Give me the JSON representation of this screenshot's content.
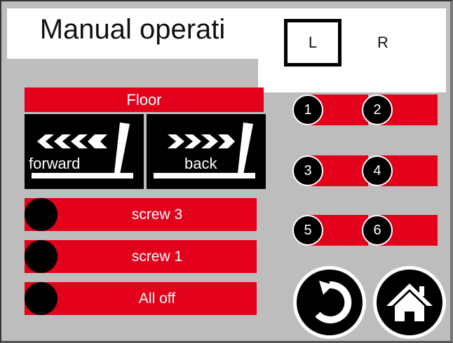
{
  "header": {
    "title": "Manual operati"
  },
  "side_selector": {
    "left_label": "L",
    "right_label": "R",
    "selected": "L"
  },
  "floor": {
    "label": "Floor"
  },
  "direction_buttons": {
    "forward_label": "forward",
    "back_label": "back"
  },
  "screw_buttons": [
    {
      "label": "screw 3"
    },
    {
      "label": "screw 1"
    },
    {
      "label": "All off"
    }
  ],
  "number_buttons": [
    "1",
    "2",
    "3",
    "4",
    "5",
    "6"
  ],
  "navigation": {
    "back_icon": "back-arrow-icon",
    "home_icon": "home-icon"
  },
  "colors": {
    "accent_red": "#e3001b",
    "background": "#bdbdbd",
    "button_black": "#000000"
  }
}
